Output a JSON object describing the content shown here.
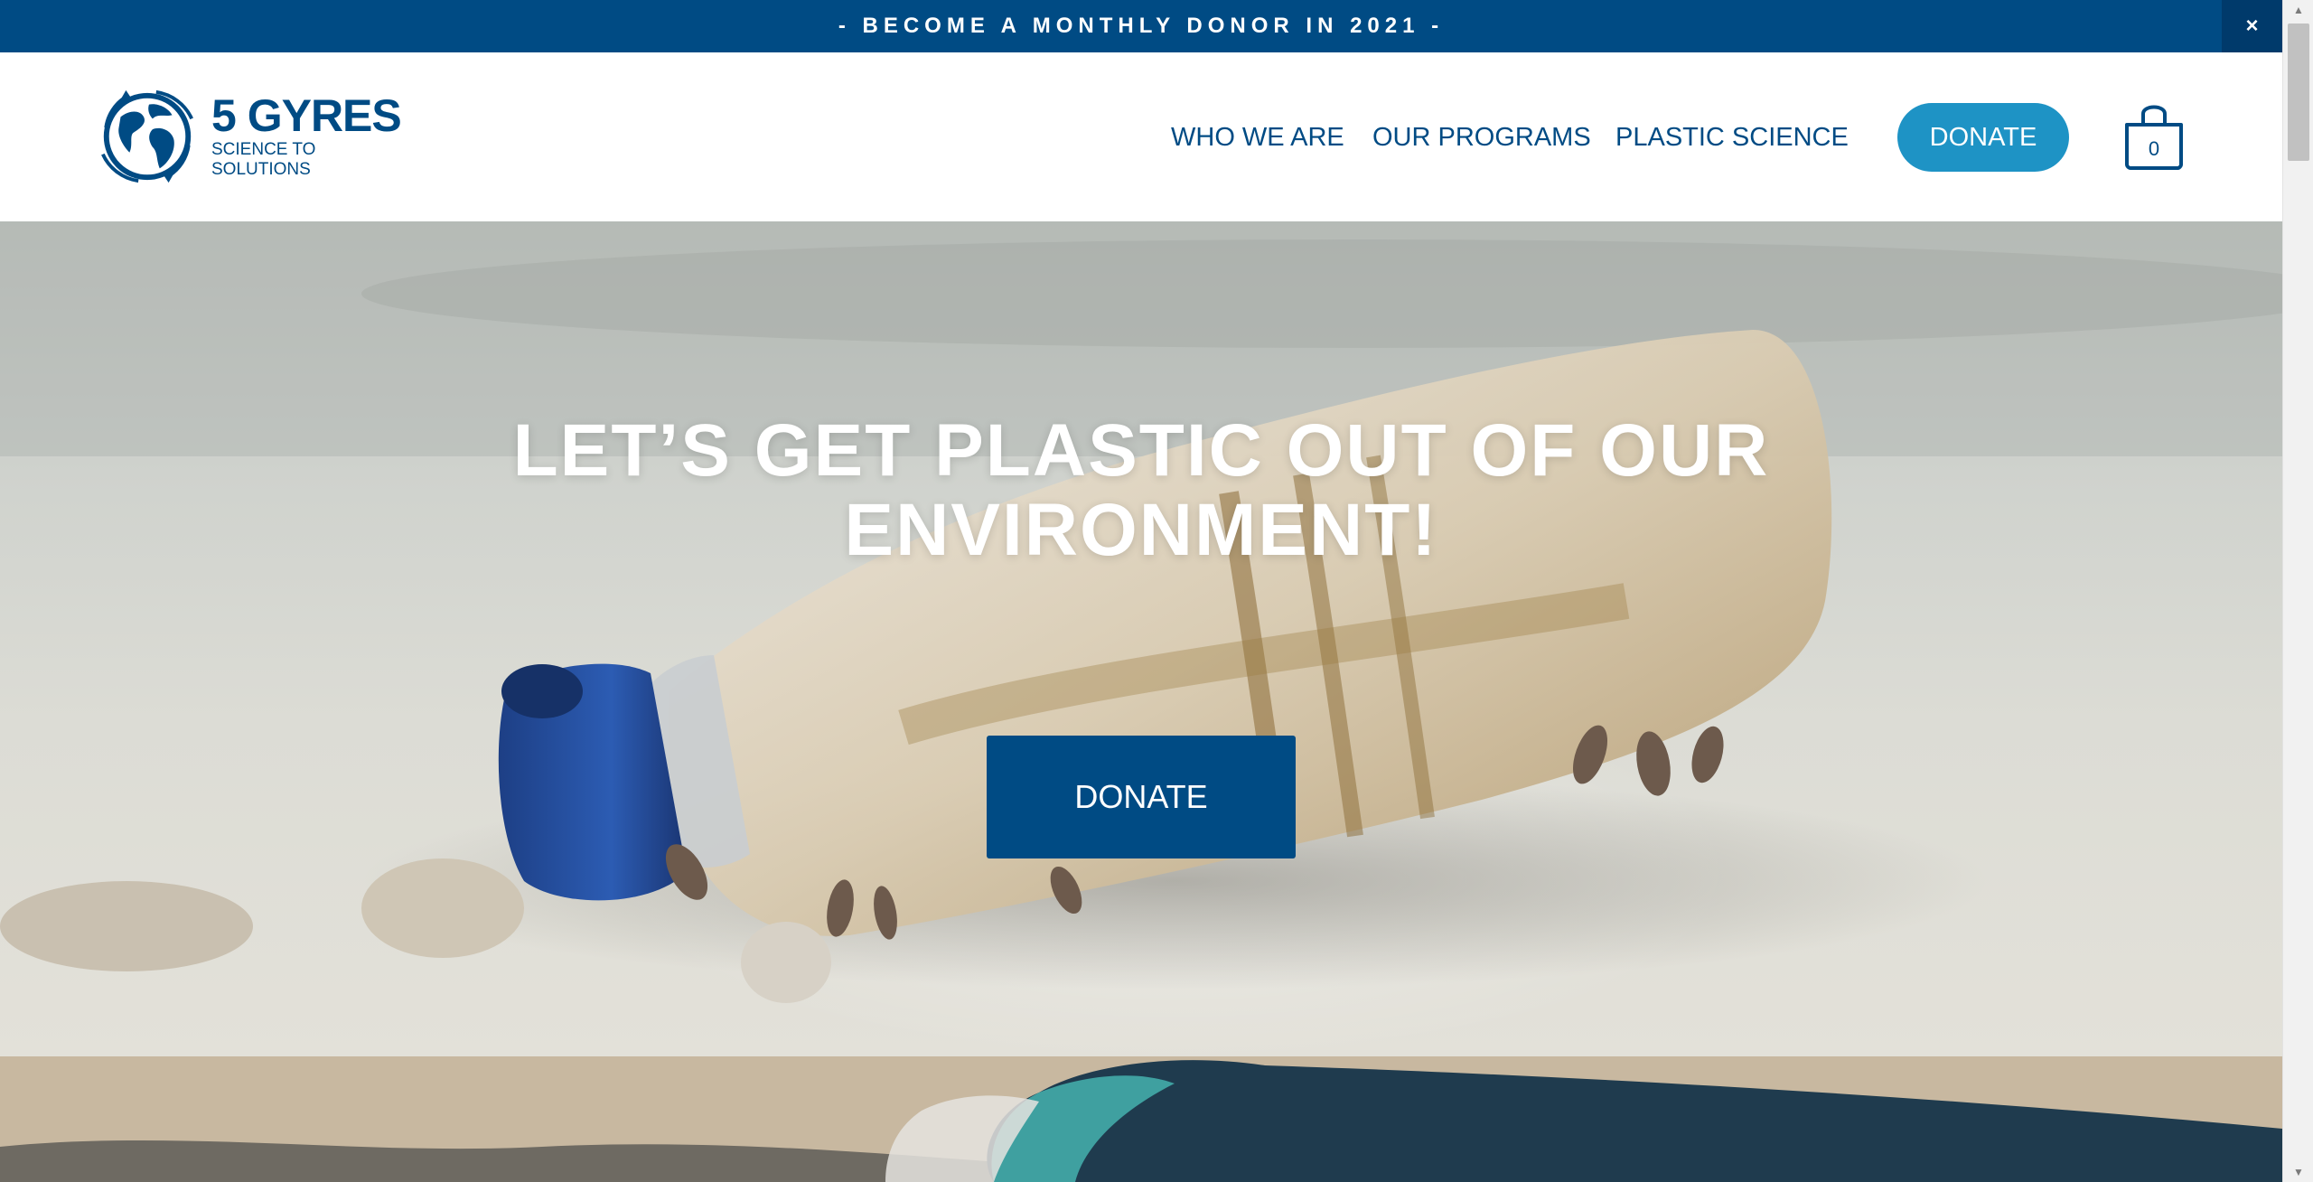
{
  "announcement": {
    "text": "- BECOME A MONTHLY DONOR IN 2021 -",
    "close_label": "×",
    "bg_color": "#004b84"
  },
  "header": {
    "logo": {
      "title": "5 GYRES",
      "subtitle": "SCIENCE TO SOLUTIONS",
      "icon": "globe-arrows-icon"
    },
    "nav": [
      {
        "label": "WHO WE ARE"
      },
      {
        "label": "OUR PROGRAMS"
      },
      {
        "label": "PLASTIC SCIENCE"
      }
    ],
    "donate_label": "DONATE",
    "donate_color": "#1e93c5",
    "cart": {
      "icon": "shopping-bag-icon",
      "count": "0"
    }
  },
  "hero": {
    "title": "LET’S GET PLASTIC OUT OF OUR ENVIRONMENT!",
    "button_label": "DONATE",
    "button_color": "#004b84"
  },
  "brand_color": "#004b84"
}
